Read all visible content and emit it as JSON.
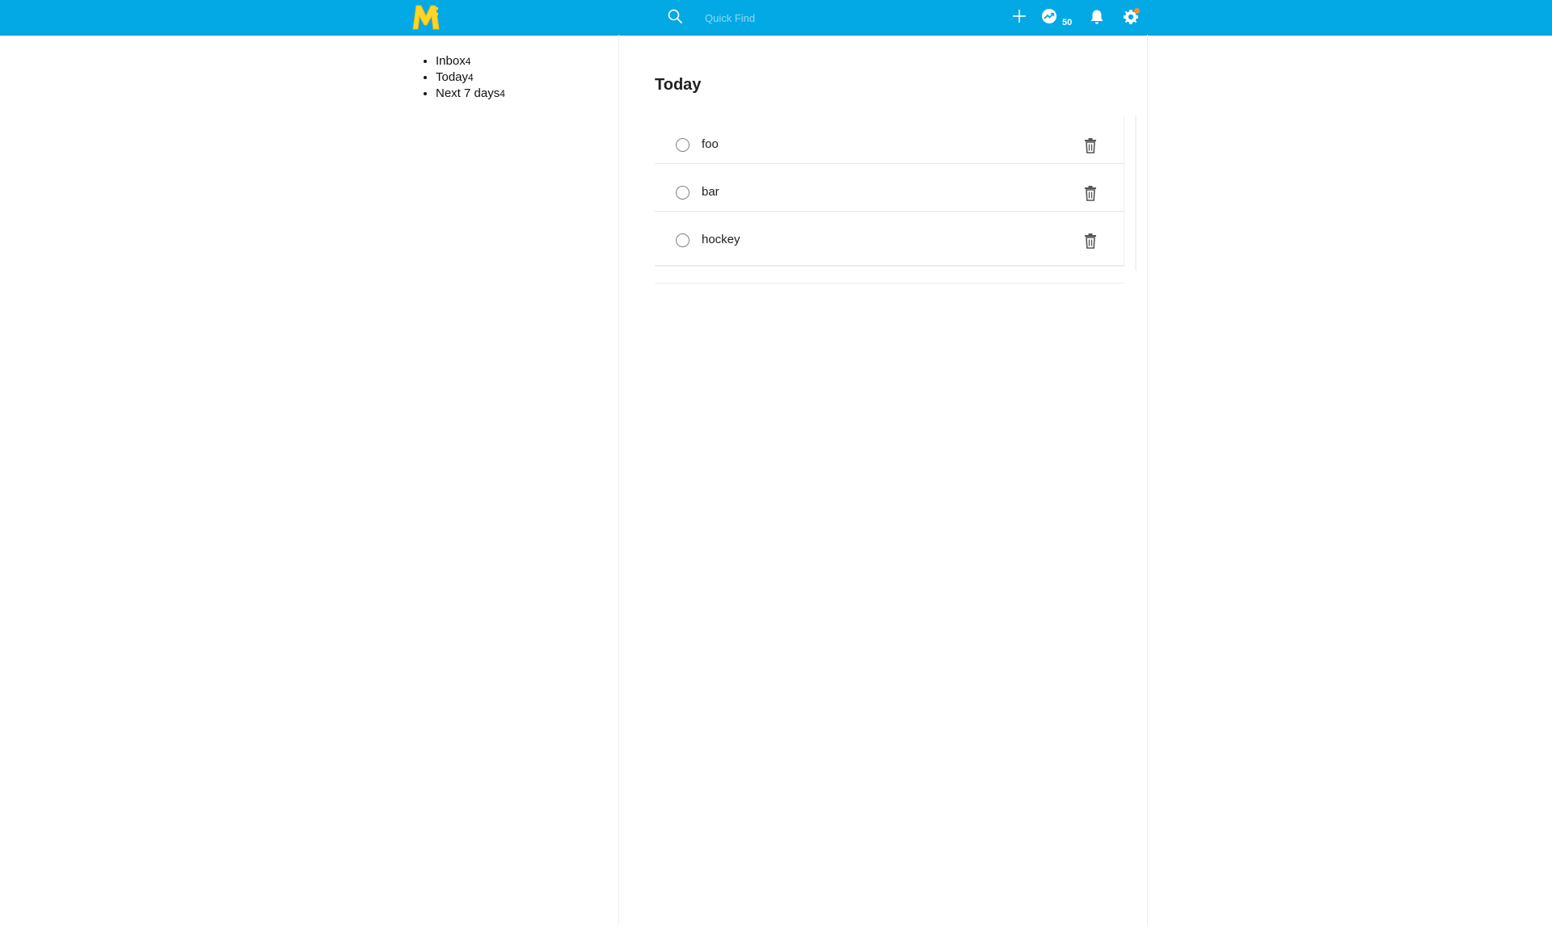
{
  "header": {
    "logo_icon": "mcontrol-logo-icon",
    "search": {
      "placeholder": "Quick Find",
      "value": ""
    },
    "karma": {
      "count": "50"
    },
    "icons": [
      "search-icon",
      "add-icon",
      "karma-icon",
      "bell-icon",
      "gear-icon"
    ],
    "accent_color": "#03a9e4",
    "notification_dot_color": "#ff8a2a"
  },
  "sidebar": {
    "items": [
      {
        "label": "Inbox",
        "count": "4"
      },
      {
        "label": "Today",
        "count": "4"
      },
      {
        "label": "Next 7 days",
        "count": "4"
      }
    ]
  },
  "main": {
    "title": "Today",
    "tasks": [
      {
        "text": "foo"
      },
      {
        "text": "bar"
      },
      {
        "text": "hockey"
      }
    ]
  }
}
